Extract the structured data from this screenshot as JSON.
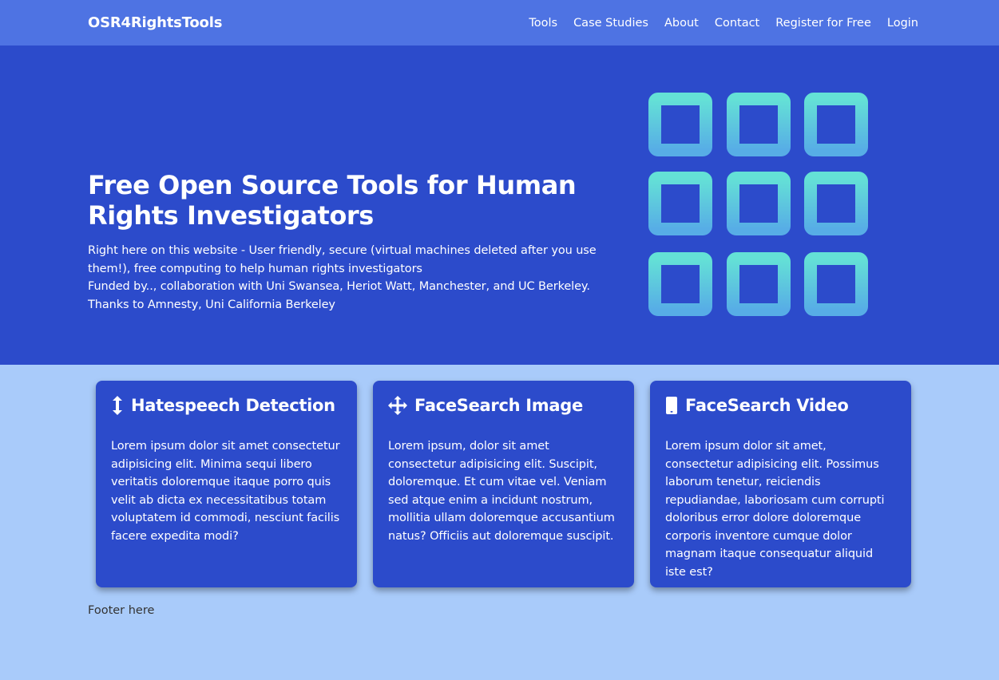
{
  "navbar": {
    "brand": "OSR4RightsTools",
    "links": [
      "Tools",
      "Case Studies",
      "About",
      "Contact",
      "Register for Free",
      "Login"
    ]
  },
  "hero": {
    "title": "Free Open Source Tools for Human Rights Investigators",
    "lines": [
      "Right here on this website - User friendly, secure (virtual machines deleted after you use them!), free computing to help human rights investigators",
      "Funded by.., collaboration with Uni Swansea, Heriot Watt, Manchester, and UC Berkeley.",
      "Thanks to Amnesty, Uni California Berkeley"
    ],
    "graphic_icon": "grid-icon"
  },
  "cards": [
    {
      "icon": "arrows-vertical-icon",
      "title": "Hatespeech Detection",
      "body": "Lorem ipsum dolor sit amet consectetur adipisicing elit. Minima sequi libero veritatis doloremque itaque porro quis velit ab dicta ex necessitatibus totam voluptatem id commodi, nesciunt facilis facere expedita modi?"
    },
    {
      "icon": "arrows-move-icon",
      "title": "FaceSearch Image",
      "body": "Lorem ipsum, dolor sit amet consectetur adipisicing elit. Suscipit, doloremque. Et cum vitae vel. Veniam sed atque enim a incidunt nostrum, mollitia ullam doloremque accusantium natus? Officiis aut doloremque suscipit."
    },
    {
      "icon": "phone-icon",
      "title": "FaceSearch Video",
      "body": "Lorem ipsum dolor sit amet, consectetur adipisicing elit. Possimus laborum tenetur, reiciendis repudiandae, laboriosam cum corrupti doloribus error dolore doloremque corporis inventore cumque dolor magnam itaque consequatur aliquid iste est?"
    }
  ],
  "footer": {
    "text": "Footer here"
  },
  "colors": {
    "navbar": "#4e73e3",
    "hero": "#2c4bcb",
    "page": "#a9cbfa",
    "grid_top": "#64e1d6",
    "grid_bottom": "#57ade6"
  }
}
